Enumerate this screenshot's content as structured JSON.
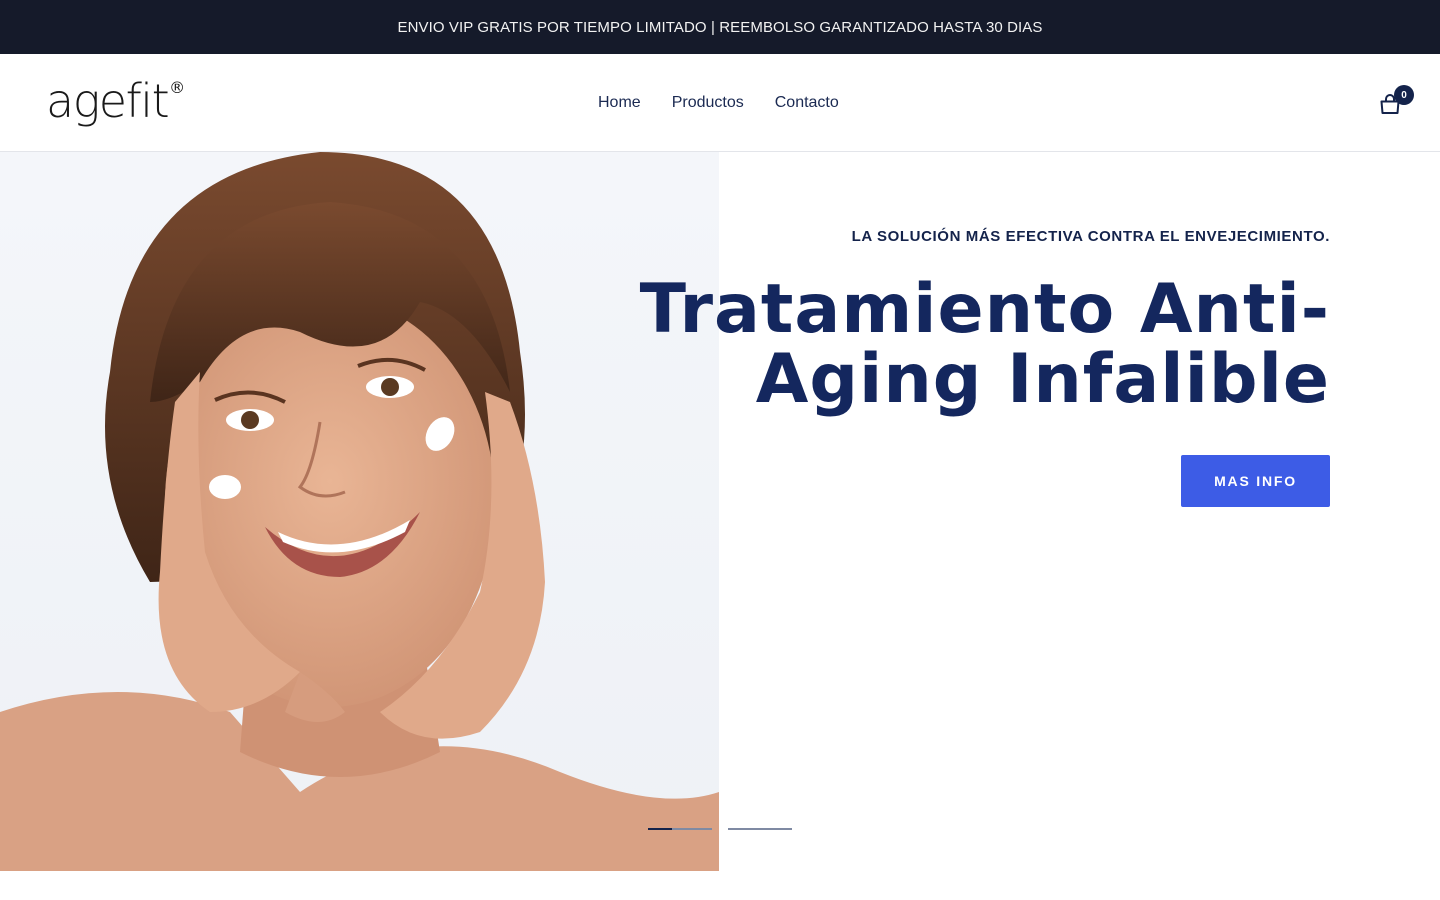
{
  "announcement": {
    "text": "ENVIO VIP GRATIS POR TIEMPO LIMITADO | REEMBOLSO GARANTIZADO HASTA 30 DIAS"
  },
  "header": {
    "logo": {
      "text": "agefit",
      "mark": "®"
    },
    "nav": [
      {
        "label": "Home"
      },
      {
        "label": "Productos"
      },
      {
        "label": "Contacto"
      }
    ],
    "cart": {
      "icon": "shopping-bag-icon",
      "count": "0"
    }
  },
  "hero": {
    "subheading": "LA SOLUCIÓN MÁS EFECTIVA CONTRA EL ENVEJECIMIENTO.",
    "title_line1": "Tratamiento Anti-",
    "title_line2": "Aging Infalible",
    "button_label": "MAS INFO",
    "image": "woman-applying-face-cream-photo",
    "slides": [
      {
        "active": true,
        "progress": 0.38
      },
      {
        "active": false,
        "progress": 0
      }
    ]
  },
  "colors": {
    "announcement_bg": "#151a2a",
    "heading": "#14275e",
    "button": "#3d5ce6"
  }
}
